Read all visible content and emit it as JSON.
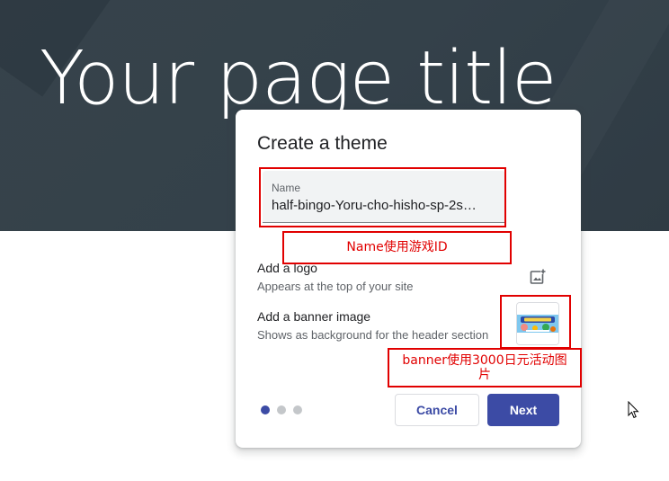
{
  "page": {
    "title": "Your page title"
  },
  "dialog": {
    "title": "Create a theme",
    "name_field": {
      "label": "Name",
      "value": "half-bingo-Yoru-cho-hisho-sp-2s…"
    },
    "logo": {
      "title": "Add a logo",
      "subtitle": "Appears at the top of your site",
      "icon": "add-photo-icon"
    },
    "banner": {
      "title": "Add a banner image",
      "subtitle": "Shows as background for the header section"
    },
    "pagination": {
      "total": 3,
      "current": 1
    },
    "cancel_label": "Cancel",
    "next_label": "Next"
  },
  "annotations": {
    "name_note": "Name使用游戏ID",
    "banner_note_line1": "banner使用3000日元活动图",
    "banner_note_line2": "片",
    "color": "#e10000"
  },
  "colors": {
    "accent": "#3c4ba5",
    "header_bg": "#37434b"
  }
}
